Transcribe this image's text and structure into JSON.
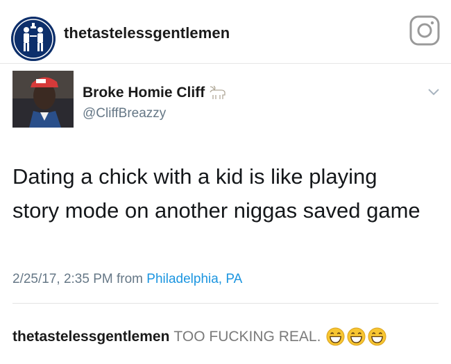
{
  "instagram": {
    "username": "thetastelessgentlemen",
    "avatar_icon": "gentlemen-logo-icon",
    "camera_icon": "instagram-camera-icon"
  },
  "tweet": {
    "display_name": "Broke Homie Cliff",
    "name_emoji": "goat-icon",
    "handle": "@CliffBreazzy",
    "text": "Dating a chick with a kid is like playing story mode on another niggas saved game",
    "timestamp": "2/25/17, 2:35 PM from",
    "location": "Philadelphia, PA",
    "menu_icon": "chevron-down-icon"
  },
  "caption": {
    "username": "thetastelessgentlemen",
    "text": "TOO FUCKING REAL.",
    "emojis": [
      "grinning-face-icon",
      "grinning-face-icon",
      "grinning-face-icon"
    ]
  },
  "colors": {
    "link": "#1b95e0",
    "secondary_text": "#657786",
    "avatar_bg": "#0d2f6b"
  }
}
